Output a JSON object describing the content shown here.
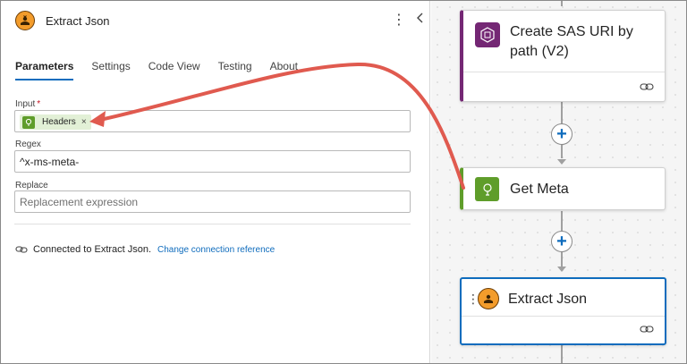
{
  "panel": {
    "title": "Extract Json",
    "tabs": [
      {
        "label": "Parameters"
      },
      {
        "label": "Settings"
      },
      {
        "label": "Code View"
      },
      {
        "label": "Testing"
      },
      {
        "label": "About"
      }
    ],
    "fields": {
      "input_label": "Input",
      "required_mark": "*",
      "token_label": "Headers",
      "token_remove": "×",
      "regex_label": "Regex",
      "regex_value": "^x-ms-meta-",
      "replace_label": "Replace",
      "replace_placeholder": "Replacement expression"
    },
    "connection": {
      "text": "Connected to Extract Json.",
      "link": "Change connection reference"
    }
  },
  "canvas": {
    "cards": [
      {
        "title": "Create SAS URI by path (V2)",
        "accent": "#742774",
        "icon": "blob-storage-icon"
      },
      {
        "title": "Get Meta",
        "accent": "#5f9d2a",
        "icon": "compose-icon"
      },
      {
        "title": "Extract Json",
        "accent": "#0f6cbd",
        "icon": "custom-connector-icon"
      }
    ],
    "add_symbol": "+"
  },
  "colors": {
    "annotation_arrow": "#e05a4f",
    "link": "#0f6cbd",
    "tab_underline": "#0f6cbd"
  }
}
